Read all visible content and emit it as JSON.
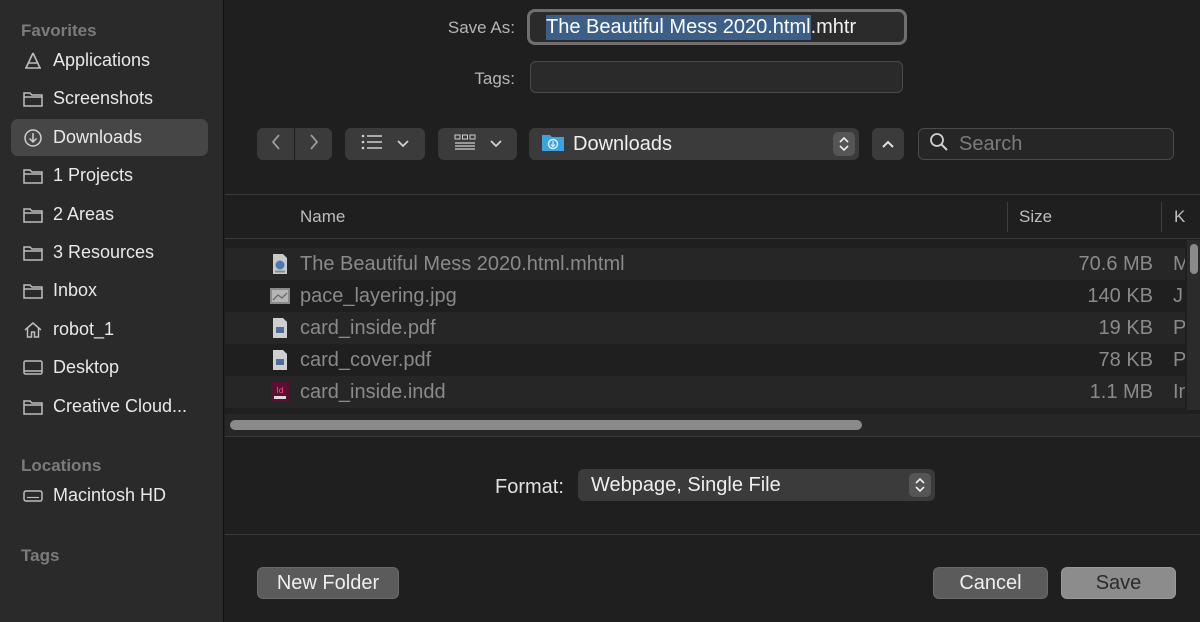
{
  "sidebar": {
    "favorites_title": "Favorites",
    "favorites": [
      {
        "label": "Applications",
        "icon": "applications-icon"
      },
      {
        "label": "Screenshots",
        "icon": "folder-icon"
      },
      {
        "label": "Downloads",
        "icon": "downloads-icon",
        "selected": true
      },
      {
        "label": "1 Projects",
        "icon": "folder-icon"
      },
      {
        "label": "2 Areas",
        "icon": "folder-icon"
      },
      {
        "label": "3 Resources",
        "icon": "folder-icon"
      },
      {
        "label": "Inbox",
        "icon": "folder-icon"
      },
      {
        "label": "robot_1",
        "icon": "home-icon"
      },
      {
        "label": "Desktop",
        "icon": "desktop-icon"
      },
      {
        "label": "Creative Cloud...",
        "icon": "folder-icon"
      }
    ],
    "locations_title": "Locations",
    "locations": [
      {
        "label": "Macintosh HD",
        "icon": "disk-icon"
      }
    ],
    "tags_title": "Tags"
  },
  "save_form": {
    "save_as_label": "Save As:",
    "filename_selected": "The Beautiful Mess 2020.html",
    "filename_rest": ".mhtr",
    "tags_label": "Tags:",
    "tags_value": ""
  },
  "toolbar": {
    "location": "Downloads",
    "search_placeholder": "Search"
  },
  "file_list": {
    "columns": {
      "name": "Name",
      "size": "Size",
      "kind": "K"
    },
    "rows": [
      {
        "name": "The Beautiful Mess 2020.html.mhtml",
        "size": "70.6 MB",
        "kind": "M",
        "icon": "webarchive-icon"
      },
      {
        "name": "pace_layering.jpg",
        "size": "140 KB",
        "kind": "J",
        "icon": "image-icon"
      },
      {
        "name": "card_inside.pdf",
        "size": "19 KB",
        "kind": "P",
        "icon": "pdf-icon"
      },
      {
        "name": "card_cover.pdf",
        "size": "78 KB",
        "kind": "P",
        "icon": "pdf-icon"
      },
      {
        "name": "card_inside.indd",
        "size": "1.1 MB",
        "kind": "In",
        "icon": "indesign-icon"
      }
    ]
  },
  "format": {
    "label": "Format:",
    "value": "Webpage, Single File"
  },
  "buttons": {
    "new_folder": "New Folder",
    "cancel": "Cancel",
    "save": "Save"
  }
}
